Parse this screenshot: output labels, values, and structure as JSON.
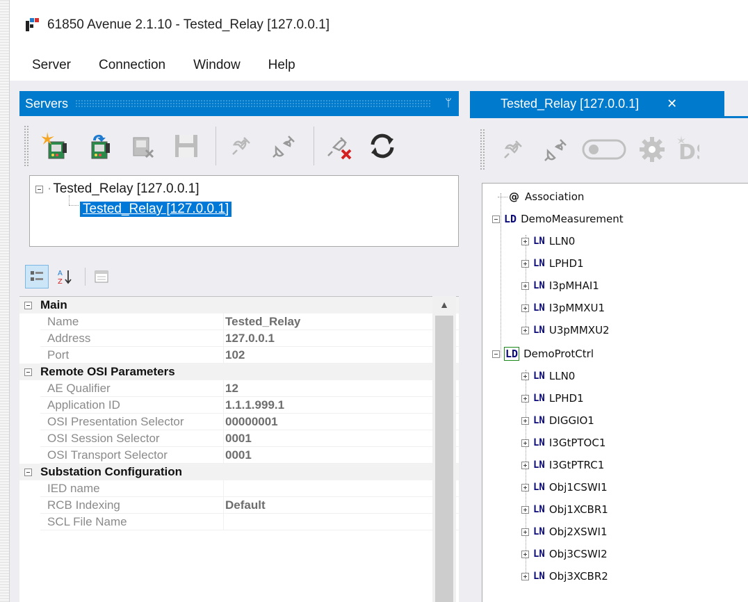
{
  "window": {
    "title": "61850 Avenue 2.1.10 - Tested_Relay [127.0.0.1]"
  },
  "menu": [
    "Server",
    "Connection",
    "Window",
    "Help"
  ],
  "servers_pane": {
    "title": "Servers",
    "pin_glyph": "ᛘ",
    "tree": {
      "root": "Tested_Relay [127.0.0.1]",
      "child": "Tested_Relay [127.0.0.1]"
    }
  },
  "properties": {
    "categories": [
      {
        "name": "Main",
        "rows": [
          {
            "label": "Name",
            "value": "Tested_Relay"
          },
          {
            "label": "Address",
            "value": "127.0.0.1"
          },
          {
            "label": "Port",
            "value": "102"
          }
        ]
      },
      {
        "name": "Remote OSI Parameters",
        "rows": [
          {
            "label": "AE Qualifier",
            "value": "12"
          },
          {
            "label": "Application ID",
            "value": "1.1.1.999.1"
          },
          {
            "label": "OSI Presentation Selector",
            "value": "00000001"
          },
          {
            "label": "OSI Session Selector",
            "value": "0001"
          },
          {
            "label": "OSI Transport Selector",
            "value": "0001"
          }
        ]
      },
      {
        "name": "Substation Configuration",
        "rows": [
          {
            "label": "IED name",
            "value": ""
          },
          {
            "label": "RCB Indexing",
            "value": "Default"
          },
          {
            "label": "SCL File Name",
            "value": ""
          }
        ]
      }
    ]
  },
  "document_tab": {
    "label": "Tested_Relay [127.0.0.1]",
    "close_glyph": "✕"
  },
  "model_tree": {
    "association": {
      "prefix": "@",
      "label": "Association"
    },
    "logical_devices": [
      {
        "tag": "LD",
        "name": "DemoMeasurement",
        "nodes": [
          "LLN0",
          "LPHD1",
          "I3pMHAI1",
          "I3pMMXU1",
          "U3pMMXU2"
        ]
      },
      {
        "tag": "LD",
        "name": "DemoProtCtrl",
        "nodes": [
          "LLN0",
          "LPHD1",
          "DIGGIO1",
          "I3GtPTOC1",
          "I3GtPTRC1",
          "Obj1CSWI1",
          "Obj1XCBR1",
          "Obj2XSWI1",
          "Obj3CSWI2",
          "Obj3XCBR2"
        ]
      }
    ],
    "ln_tag": "LN"
  },
  "toolbar_icons": {
    "servers": [
      "add-server-icon",
      "connect-server-icon",
      "remove-server-icon",
      "save-icon",
      "connect-icon",
      "disconnect-icon",
      "disconnect-remove-icon",
      "refresh-icon"
    ],
    "document": [
      "connect-icon",
      "disconnect-icon",
      "toggle-icon",
      "settings-icon",
      "dataset-icon"
    ]
  },
  "colors": {
    "accent": "#007acc",
    "selection": "#0078d7",
    "tree_tag": "#0a0a7a"
  }
}
